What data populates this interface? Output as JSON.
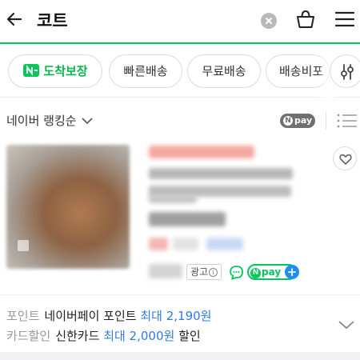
{
  "header": {
    "query": "코트",
    "icons": [
      "back-arrow-icon",
      "clear-icon",
      "basket-icon",
      "menu-icon"
    ]
  },
  "chips": {
    "arrival": "도착보장",
    "fast": "빠른배송",
    "free": "무료배송",
    "ship_free_partial": "배송비포"
  },
  "sort": {
    "label": "네이버 랭킹순",
    "npay_filter": "pay"
  },
  "product": {
    "ad_label": "광고",
    "ad_info": "i",
    "npay_label": "pay"
  },
  "benefits": {
    "row1": {
      "key": "포인트",
      "value": "네이버페이 포인트",
      "highlight": "최대 2,190원"
    },
    "row2": {
      "key": "카드할인",
      "value": "신한카드",
      "highlight": "최대 2,000원",
      "suffix": "할인"
    }
  },
  "colors": {
    "brand_green": "#03c75a",
    "highlight_blue": "#2f7be5",
    "plus_blue": "#1e8ef0"
  }
}
